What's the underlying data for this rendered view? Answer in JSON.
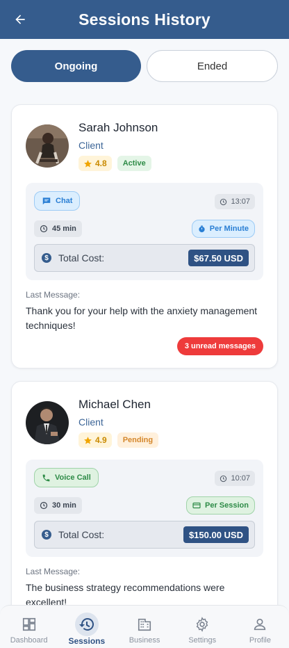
{
  "header": {
    "title": "Sessions History"
  },
  "tabs": [
    {
      "label": "Ongoing",
      "active": true
    },
    {
      "label": "Ended",
      "active": false
    }
  ],
  "sessions": [
    {
      "name": "Sarah Johnson",
      "role": "Client",
      "rating": "4.8",
      "status": "Active",
      "type": "Chat",
      "time": "13:07",
      "duration": "45 min",
      "rate_type": "Per Minute",
      "total_cost_label": "Total Cost:",
      "total_cost": "$67.50 USD",
      "last_message_label": "Last Message:",
      "last_message": "Thank you for your help with the anxiety management techniques!",
      "unread": "3 unread messages"
    },
    {
      "name": "Michael Chen",
      "role": "Client",
      "rating": "4.9",
      "status": "Pending",
      "type": "Voice Call",
      "time": "10:07",
      "duration": "30 min",
      "rate_type": "Per Session",
      "total_cost_label": "Total Cost:",
      "total_cost": "$150.00 USD",
      "last_message_label": "Last Message:",
      "last_message": "The business strategy recommendations were excellent!"
    }
  ],
  "nav": [
    {
      "label": "Dashboard",
      "icon": "dashboard-icon",
      "active": false
    },
    {
      "label": "Sessions",
      "icon": "history-icon",
      "active": true
    },
    {
      "label": "Business",
      "icon": "business-icon",
      "active": false
    },
    {
      "label": "Settings",
      "icon": "gear-icon",
      "active": false
    },
    {
      "label": "Profile",
      "icon": "person-icon",
      "active": false
    }
  ],
  "colors": {
    "primary": "#355c8d",
    "danger": "#ee3b3b",
    "success": "#2e8b47",
    "warning": "#d4872c"
  }
}
